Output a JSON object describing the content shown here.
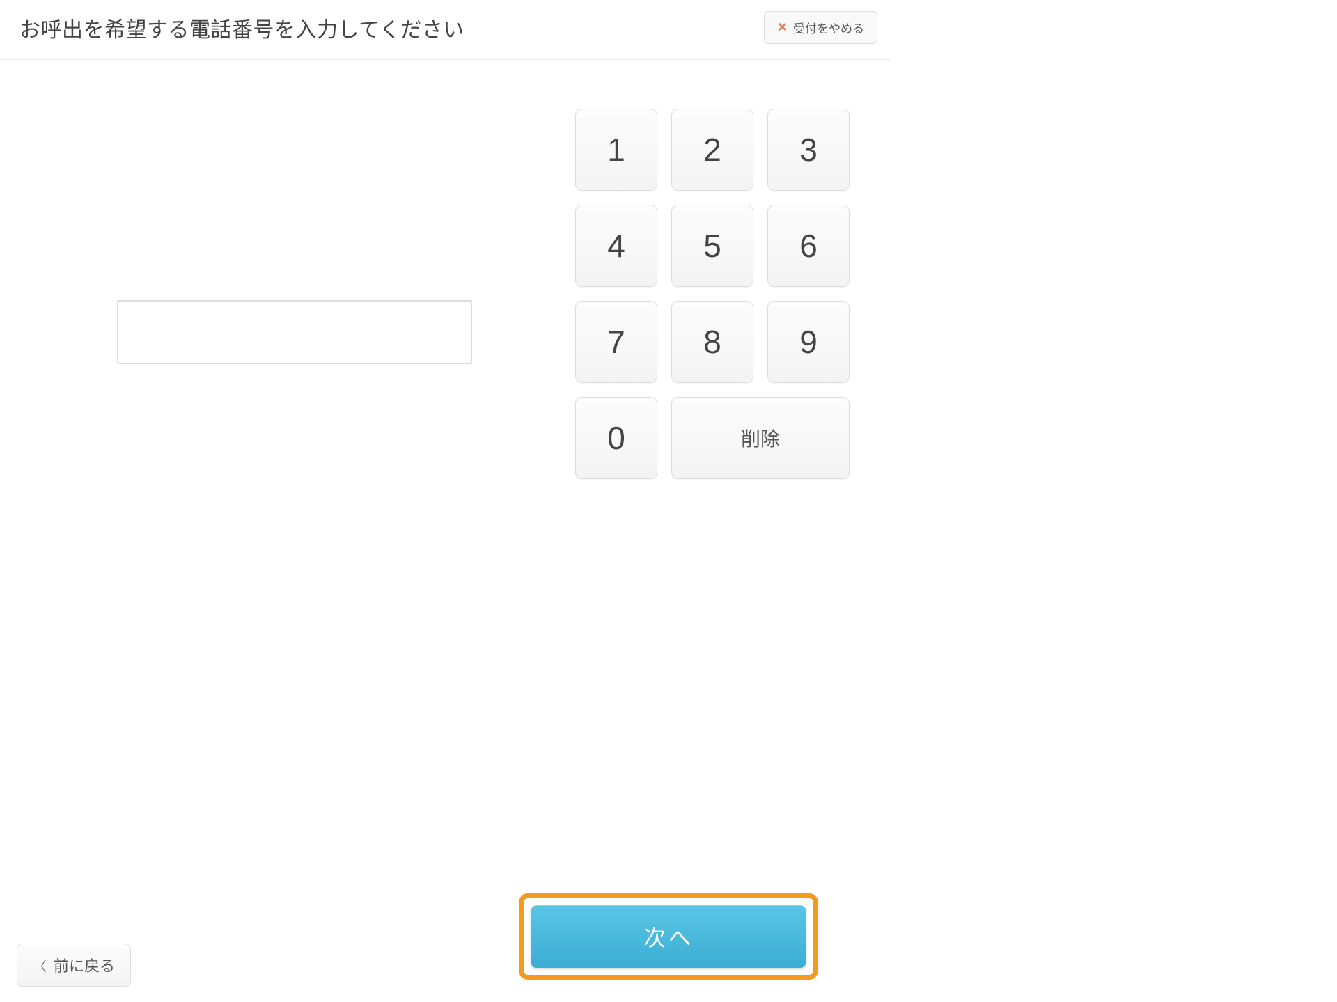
{
  "header": {
    "title": "お呼出を希望する電話番号を入力してください",
    "cancel_label": "受付をやめる"
  },
  "input": {
    "value": ""
  },
  "keypad": {
    "keys": [
      "1",
      "2",
      "3",
      "4",
      "5",
      "6",
      "7",
      "8",
      "9",
      "0"
    ],
    "delete_label": "削除"
  },
  "footer": {
    "back_label": "前に戻る",
    "next_label": "次へ"
  }
}
